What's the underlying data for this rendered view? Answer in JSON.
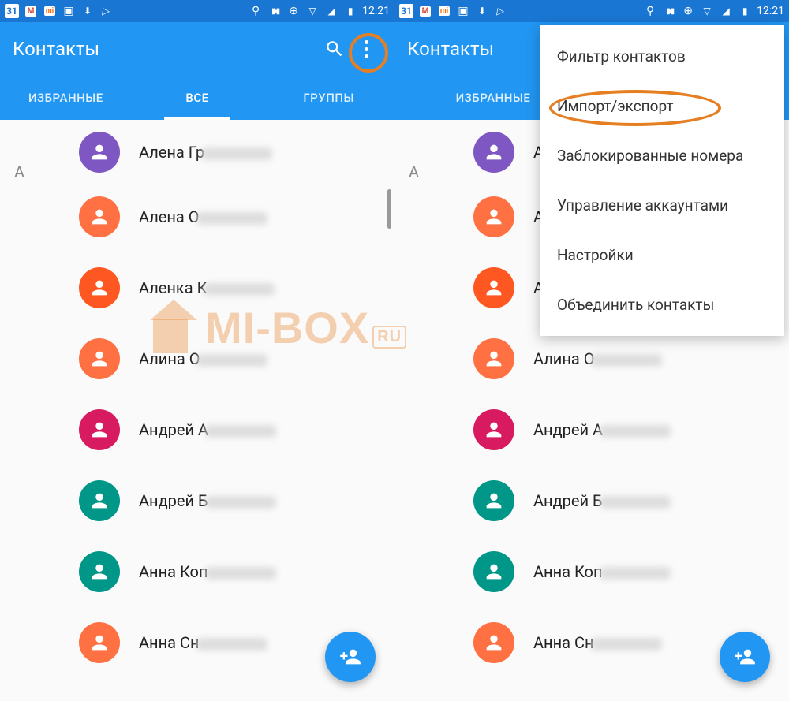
{
  "statusbar": {
    "calendar_day": "31",
    "time": "12:21"
  },
  "appbar": {
    "title": "Контакты"
  },
  "tabs": {
    "favorites": "ИЗБРАННЫЕ",
    "all": "ВСЕ",
    "groups": "ГРУППЫ"
  },
  "section_letter": "А",
  "contacts": [
    {
      "name": "Алена Гр",
      "color": "#7e57c2"
    },
    {
      "name": "Алена О",
      "color": "#ff7043"
    },
    {
      "name": "Аленка К",
      "color": "#ff5722"
    },
    {
      "name": "Алина О",
      "color": "#ff7043"
    },
    {
      "name": "Андрей А",
      "color": "#d81b60"
    },
    {
      "name": "Андрей Б",
      "color": "#009688"
    },
    {
      "name": "Анна Коп",
      "color": "#009688"
    },
    {
      "name": "Анна Сн",
      "color": "#ff7043"
    }
  ],
  "menu": {
    "filter": "Фильтр контактов",
    "import_export": "Импорт/экспорт",
    "blocked": "Заблокированные номера",
    "accounts": "Управление аккаунтами",
    "settings": "Настройки",
    "merge": "Объединить контакты"
  },
  "watermark": {
    "text": "MI-BOX",
    "tld": "RU"
  }
}
